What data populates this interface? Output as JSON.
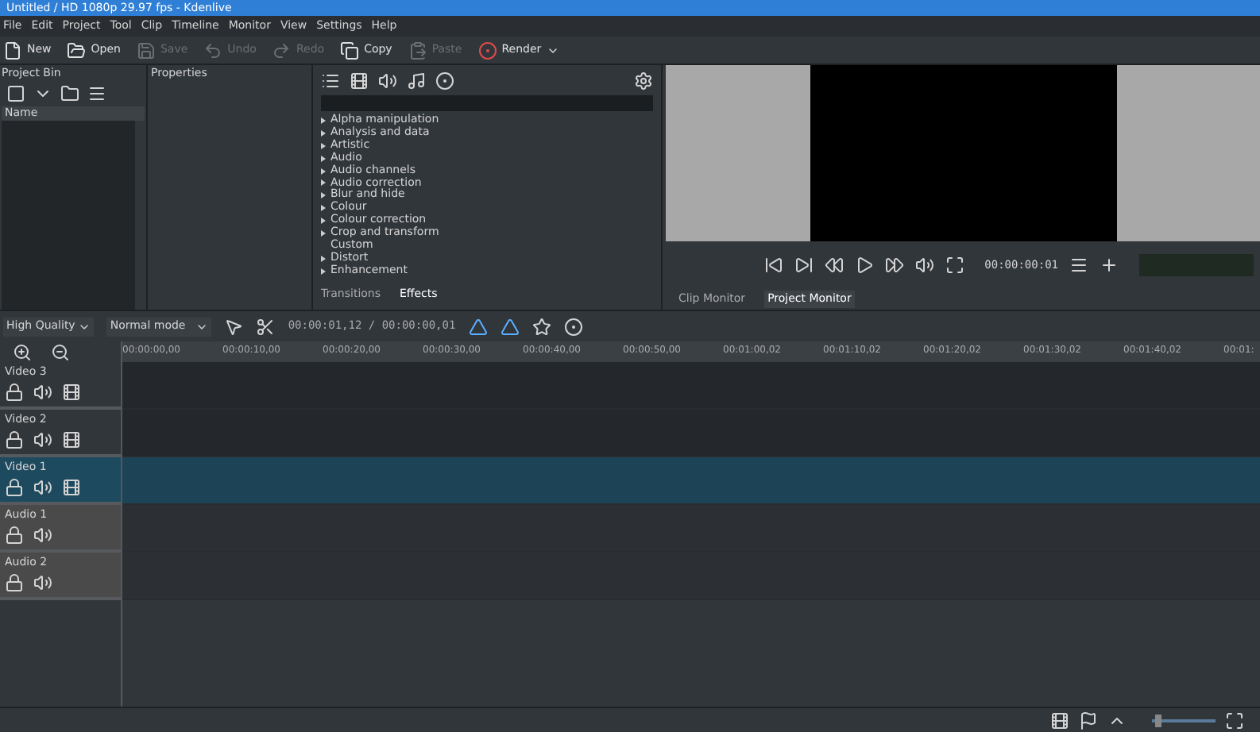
{
  "window": {
    "title": "Untitled / HD 1080p 29.97 fps - Kdenlive"
  },
  "menu": [
    "File",
    "Edit",
    "Project",
    "Tool",
    "Clip",
    "Timeline",
    "Monitor",
    "View",
    "Settings",
    "Help"
  ],
  "toolbar": [
    {
      "label": "New",
      "kind": "new",
      "disabled": false
    },
    {
      "label": "Open",
      "kind": "open",
      "disabled": false
    },
    {
      "label": "Save",
      "kind": "save",
      "disabled": true
    },
    {
      "label": "Undo",
      "kind": "undo",
      "disabled": true
    },
    {
      "label": "Redo",
      "kind": "redo",
      "disabled": true
    },
    {
      "label": "Copy",
      "kind": "copy",
      "disabled": false
    },
    {
      "label": "Paste",
      "kind": "paste",
      "disabled": true
    },
    {
      "label": "Render",
      "kind": "render",
      "disabled": false
    }
  ],
  "project_bin": {
    "title": "Project Bin",
    "column": "Name"
  },
  "properties": {
    "title": "Properties"
  },
  "effects": {
    "categories": [
      {
        "label": "Alpha manipulation",
        "expandable": true
      },
      {
        "label": "Analysis and data",
        "expandable": true
      },
      {
        "label": "Artistic",
        "expandable": true
      },
      {
        "label": "Audio",
        "expandable": true
      },
      {
        "label": "Audio channels",
        "expandable": true
      },
      {
        "label": "Audio correction",
        "expandable": true
      },
      {
        "label": "Blur and hide",
        "expandable": true
      },
      {
        "label": "Colour",
        "expandable": true
      },
      {
        "label": "Colour correction",
        "expandable": true
      },
      {
        "label": "Crop and transform",
        "expandable": true
      },
      {
        "label": "Custom",
        "expandable": false
      },
      {
        "label": "Distort",
        "expandable": true
      },
      {
        "label": "Enhancement",
        "expandable": true
      }
    ],
    "tabs": [
      {
        "label": "Transitions",
        "selected": false
      },
      {
        "label": "Effects",
        "selected": true
      }
    ]
  },
  "monitor": {
    "timecode": "00:00:00:01",
    "tabs": [
      {
        "label": "Clip Monitor",
        "selected": false
      },
      {
        "label": "Project Monitor",
        "selected": true
      }
    ]
  },
  "timeline": {
    "quality": "High Quality",
    "mode": "Normal mode",
    "position": "00:00:01,12 / 00:00:00,01",
    "ruler": [
      "00:00:00,00",
      "00:00:10,00",
      "00:00:20,00",
      "00:00:30,00",
      "00:00:40,00",
      "00:00:50,00",
      "00:01:00,02",
      "00:01:10,02",
      "00:01:20,02",
      "00:01:30,02",
      "00:01:40,02",
      "00:01:"
    ],
    "zoom": {
      "level": 0.1
    },
    "tracks": [
      {
        "name": "Video 3",
        "kind": "video",
        "selected": false
      },
      {
        "name": "Video 2",
        "kind": "video",
        "selected": false
      },
      {
        "name": "Video 1",
        "kind": "video",
        "selected": true
      },
      {
        "name": "Audio 1",
        "kind": "audio",
        "selected": false
      },
      {
        "name": "Audio 2",
        "kind": "audio",
        "selected": false
      }
    ]
  }
}
